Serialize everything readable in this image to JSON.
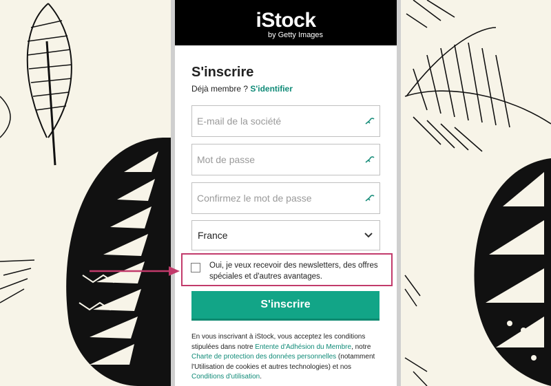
{
  "brand": {
    "logo": "iStock",
    "sub": "by Getty Images"
  },
  "form": {
    "title": "S'inscrire",
    "already_member": "Déjà membre ?",
    "signin_link": "S'identifier",
    "email_placeholder": "E-mail de la société",
    "password_placeholder": "Mot de passe",
    "confirm_placeholder": "Confirmez le mot de passe",
    "country_value": "France",
    "newsletter_label": "Oui, je veux recevoir des newsletters, des offres spéciales et d'autres avantages.",
    "newsletter_checked": false,
    "submit_label": "S'inscrire"
  },
  "legal": {
    "part1": "En vous inscrivant à iStock, vous acceptez les conditions stipulées dans notre ",
    "link1": "Entente d'Adhésion du Membre",
    "part2": ", notre ",
    "link2": "Charte de protection des données personnelles",
    "part3": " (notamment l'Utilisation de cookies et autres technologies) et nos ",
    "link3": "Conditions d'utilisation",
    "part4": "."
  },
  "colors": {
    "accent": "#12a587",
    "highlight": "#c23a6b",
    "link": "#0f8a77"
  },
  "icons": [
    "key-icon",
    "chevron-down-icon",
    "checkbox",
    "arrow-icon"
  ]
}
